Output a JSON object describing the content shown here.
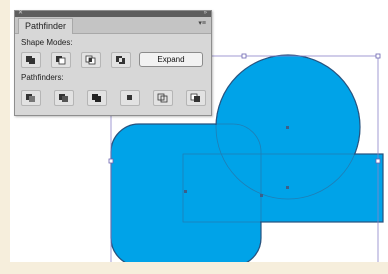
{
  "panel": {
    "tab_label": "Pathfinder",
    "shape_modes_label": "Shape Modes:",
    "pathfinders_label": "Pathfinders:",
    "expand_label": "Expand",
    "shape_mode_icons": [
      "unite-icon",
      "minus-front-icon",
      "intersect-icon",
      "exclude-icon"
    ],
    "pathfinder_icons": [
      "divide-icon",
      "trim-icon",
      "merge-icon",
      "crop-icon",
      "outline-icon",
      "minus-back-icon"
    ]
  },
  "colors": {
    "shape_fill": "#00a3e8",
    "shape_stroke": "#1b4a77",
    "selection": "#8a82c9",
    "canvas_border": "#f6eedc"
  }
}
